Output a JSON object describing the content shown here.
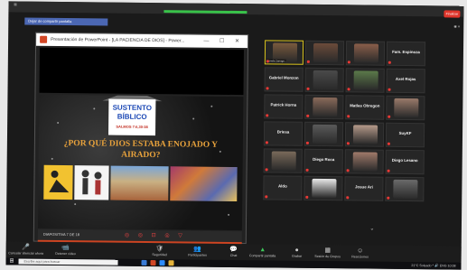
{
  "zoom": {
    "share_banner": "Dejar de compartir pantalla",
    "win_controls_right": "◉ ≡"
  },
  "ppt": {
    "title": "Presentación de PowerPoint - [LA PACIENCIA DE DIOS] - Power...",
    "controls": "— ☐ ✕",
    "slide": {
      "sign_line1": "SUSTENTO",
      "sign_line2": "BÍBLICO",
      "sign_ref": "SALMOS 7:6,30-38",
      "question": "¿POR QUÉ DIOS ESTABA ENOJADO Y AIRADO?"
    },
    "slide_counter": "DIAPOSITIVA 7 DE 18",
    "slide_controls": "◎ ◎ ⊡ ◎ ▽"
  },
  "gallery": [
    {
      "type": "video",
      "label": "Pamela Zarragu...",
      "color": "#7a5a3e",
      "active": true
    },
    {
      "type": "video",
      "label": "",
      "color": "#6b4b3a"
    },
    {
      "type": "video",
      "label": "",
      "color": "#8a5e4a"
    },
    {
      "type": "name",
      "name": "Fam. Espinoza"
    },
    {
      "type": "name",
      "name": "Gabriel Monzon"
    },
    {
      "type": "video",
      "label": "",
      "color": "#4a4a4a"
    },
    {
      "type": "video",
      "label": "",
      "color": "#5b7a4a"
    },
    {
      "type": "name",
      "name": "Axel Rojas"
    },
    {
      "type": "name",
      "name": "Patrick Horna"
    },
    {
      "type": "video",
      "label": "",
      "color": "#8a6a5a"
    },
    {
      "type": "name",
      "name": "Matías Obregon"
    },
    {
      "type": "video",
      "label": "",
      "color": "#9a7a6a"
    },
    {
      "type": "name",
      "name": "Briesa"
    },
    {
      "type": "video",
      "label": "",
      "color": "#5a5a5a"
    },
    {
      "type": "video",
      "label": "",
      "color": "#b59a8a"
    },
    {
      "type": "name",
      "name": "SuyKF"
    },
    {
      "type": "video",
      "label": "",
      "color": "#7a6a5a"
    },
    {
      "type": "name",
      "name": "Diego Roca"
    },
    {
      "type": "video",
      "label": "",
      "color": "#a07a6a"
    },
    {
      "type": "name",
      "name": "Diego Lesano"
    },
    {
      "type": "name",
      "name": "Aldo"
    },
    {
      "type": "video",
      "label": "",
      "color": "#e8e8e8"
    },
    {
      "type": "name",
      "name": "Josue Ari"
    },
    {
      "type": "video",
      "label": "",
      "color": "#6a6a6a"
    }
  ],
  "toolbar": {
    "items": [
      {
        "icon": "🎤",
        "label": "Cancelar silenciar ahora"
      },
      {
        "icon": "📹",
        "label": "Detener vídeo"
      },
      {
        "icon": "🛡",
        "label": "Seguridad"
      },
      {
        "icon": "👥",
        "label": "Participantes"
      },
      {
        "icon": "💬",
        "label": "Chat"
      },
      {
        "icon": "▲",
        "label": "Compartir pantalla"
      },
      {
        "icon": "●",
        "label": "Grabar"
      },
      {
        "icon": "▦",
        "label": "Sesión de Grupos"
      },
      {
        "icon": "☺",
        "label": "Reacciones"
      }
    ],
    "end_label": "Finalizar"
  },
  "taskbar": {
    "search_placeholder": "Escribe aquí para buscar",
    "tray": "21°C Soleado  ^ 🔊  ENG  10:08"
  },
  "colors": {
    "zoom_share_green": "#39c24a",
    "ppt_orange": "#d24726",
    "question_orange": "#e8a23c",
    "end_red": "#e0352b"
  }
}
